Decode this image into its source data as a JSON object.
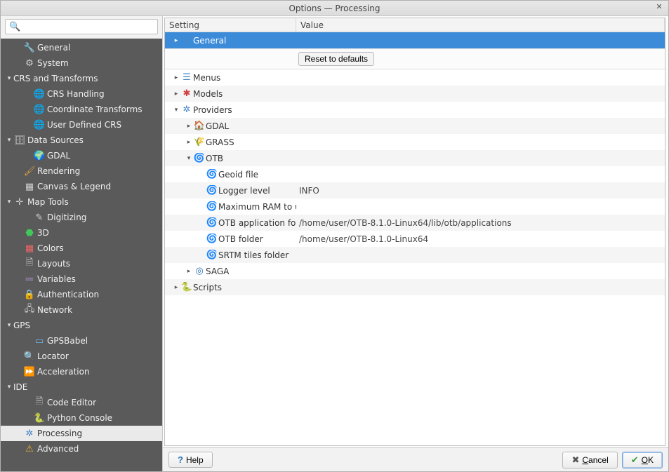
{
  "window": {
    "title": "Options — Processing"
  },
  "search": {
    "placeholder": ""
  },
  "sidebar": [
    {
      "caret": "",
      "indent": 14,
      "icon": "🔧",
      "icon_color": "#d9b84a",
      "label": "General"
    },
    {
      "caret": "",
      "indent": 14,
      "icon": "⚙",
      "icon_color": "#cfcfcf",
      "label": "System"
    },
    {
      "caret": "▾",
      "indent": 0,
      "icon": "",
      "icon_color": "",
      "label": "CRS and Transforms"
    },
    {
      "caret": "",
      "indent": 28,
      "icon": "🌐",
      "icon_color": "#6fb6e6",
      "label": "CRS Handling"
    },
    {
      "caret": "",
      "indent": 28,
      "icon": "🌐",
      "icon_color": "#6fb6e6",
      "label": "Coordinate Transforms"
    },
    {
      "caret": "",
      "indent": 28,
      "icon": "🌐",
      "icon_color": "#6fb6e6",
      "label": "User Defined CRS"
    },
    {
      "caret": "▾",
      "indent": 0,
      "icon": "🗄",
      "icon_color": "#cfcfcf",
      "label": "Data Sources"
    },
    {
      "caret": "",
      "indent": 28,
      "icon": "🌍",
      "icon_color": "#6fb6e6",
      "label": "GDAL"
    },
    {
      "caret": "",
      "indent": 14,
      "icon": "🖌",
      "icon_color": "#e0a040",
      "label": "Rendering"
    },
    {
      "caret": "",
      "indent": 14,
      "icon": "▦",
      "icon_color": "#cfcfcf",
      "label": "Canvas & Legend"
    },
    {
      "caret": "▾",
      "indent": 0,
      "icon": "✛",
      "icon_color": "#cfcfcf",
      "label": "Map Tools"
    },
    {
      "caret": "",
      "indent": 28,
      "icon": "✎",
      "icon_color": "#cfcfcf",
      "label": "Digitizing"
    },
    {
      "caret": "",
      "indent": 14,
      "icon": "⬣",
      "icon_color": "#42c858",
      "label": "3D"
    },
    {
      "caret": "",
      "indent": 14,
      "icon": "▦",
      "icon_color": "#e66",
      "label": "Colors"
    },
    {
      "caret": "",
      "indent": 14,
      "icon": "🗎",
      "icon_color": "#cfcfcf",
      "label": "Layouts"
    },
    {
      "caret": "",
      "indent": 14,
      "icon": "≔",
      "icon_color": "#b090d0",
      "label": "Variables"
    },
    {
      "caret": "",
      "indent": 14,
      "icon": "🔒",
      "icon_color": "#e6b84a",
      "label": "Authentication"
    },
    {
      "caret": "",
      "indent": 14,
      "icon": "🖧",
      "icon_color": "#cfcfcf",
      "label": "Network"
    },
    {
      "caret": "▾",
      "indent": 0,
      "icon": "",
      "icon_color": "",
      "label": "GPS"
    },
    {
      "caret": "",
      "indent": 28,
      "icon": "▭",
      "icon_color": "#6fb6e6",
      "label": "GPSBabel"
    },
    {
      "caret": "",
      "indent": 14,
      "icon": "🔍",
      "icon_color": "#bfbfbf",
      "label": "Locator"
    },
    {
      "caret": "",
      "indent": 14,
      "icon": "⏩",
      "icon_color": "#9a9a9a",
      "label": "Acceleration"
    },
    {
      "caret": "▾",
      "indent": 0,
      "icon": "",
      "icon_color": "",
      "label": "IDE"
    },
    {
      "caret": "",
      "indent": 28,
      "icon": "🗎",
      "icon_color": "#cfcfcf",
      "label": "Code Editor"
    },
    {
      "caret": "",
      "indent": 28,
      "icon": "🐍",
      "icon_color": "#e6c84a",
      "label": "Python Console"
    },
    {
      "caret": "",
      "indent": 14,
      "icon": "✲",
      "icon_color": "#4a87c8",
      "label": "Processing",
      "selected": true
    },
    {
      "caret": "",
      "indent": 14,
      "icon": "⚠",
      "icon_color": "#e6b030",
      "label": "Advanced"
    }
  ],
  "tree": {
    "headers": {
      "setting": "Setting",
      "value": "Value"
    },
    "reset_label": "Reset to defaults",
    "rows": [
      {
        "caret": "▸",
        "indent": 0,
        "icon": "✲",
        "icon_color": "#4a87c8",
        "label": "General",
        "value": "",
        "selected": true
      },
      {
        "caret": "▸",
        "indent": 0,
        "icon": "☰",
        "icon_color": "#4a87c8",
        "label": "Menus",
        "value": ""
      },
      {
        "caret": "▸",
        "indent": 0,
        "icon": "✱",
        "icon_color": "#d04040",
        "label": "Models",
        "value": ""
      },
      {
        "caret": "▾",
        "indent": 0,
        "icon": "✲",
        "icon_color": "#4a87c8",
        "label": "Providers",
        "value": ""
      },
      {
        "caret": "▸",
        "indent": 18,
        "icon": "🏠",
        "icon_color": "#3a9a3a",
        "label": "GDAL",
        "value": ""
      },
      {
        "caret": "▸",
        "indent": 18,
        "icon": "🌾",
        "icon_color": "#3a9a3a",
        "label": "GRASS",
        "value": ""
      },
      {
        "caret": "▾",
        "indent": 18,
        "icon": "🌀",
        "icon_color": "#c05028",
        "label": "OTB",
        "value": ""
      },
      {
        "caret": "",
        "indent": 36,
        "icon": "🌀",
        "icon_color": "#c05028",
        "label": "Geoid file",
        "value": ""
      },
      {
        "caret": "",
        "indent": 36,
        "icon": "🌀",
        "icon_color": "#c05028",
        "label": "Logger level",
        "value": "INFO"
      },
      {
        "caret": "",
        "indent": 36,
        "icon": "🌀",
        "icon_color": "#c05028",
        "label": "Maximum RAM to use",
        "value": ""
      },
      {
        "caret": "",
        "indent": 36,
        "icon": "🌀",
        "icon_color": "#c05028",
        "label": "OTB application folder",
        "value": "/home/user/OTB-8.1.0-Linux64/lib/otb/applications"
      },
      {
        "caret": "",
        "indent": 36,
        "icon": "🌀",
        "icon_color": "#c05028",
        "label": "OTB folder",
        "value": "/home/user/OTB-8.1.0-Linux64"
      },
      {
        "caret": "",
        "indent": 36,
        "icon": "🌀",
        "icon_color": "#c05028",
        "label": "SRTM tiles folder",
        "value": ""
      },
      {
        "caret": "▸",
        "indent": 18,
        "icon": "◎",
        "icon_color": "#2a6fb5",
        "label": "SAGA",
        "value": ""
      },
      {
        "caret": "▸",
        "indent": 0,
        "icon": "🐍",
        "icon_color": "#e6c84a",
        "label": "Scripts",
        "value": ""
      }
    ]
  },
  "footer": {
    "help": "Help",
    "cancel": "Cancel",
    "ok": "OK",
    "cancel_accel": "C",
    "ok_accel": "O"
  }
}
